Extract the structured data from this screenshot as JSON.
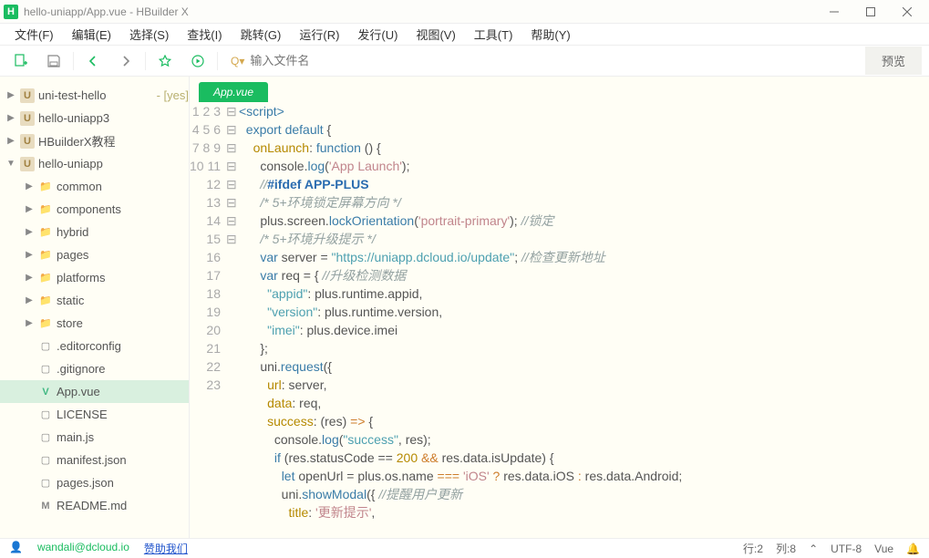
{
  "titlebar": {
    "appicon": "H",
    "title": "hello-uniapp/App.vue - HBuilder X"
  },
  "menubar": {
    "items": [
      "文件(F)",
      "编辑(E)",
      "选择(S)",
      "查找(I)",
      "跳转(G)",
      "运行(R)",
      "发行(U)",
      "视图(V)",
      "工具(T)",
      "帮助(Y)"
    ]
  },
  "toolbar": {
    "search_prefix": "Q▾",
    "search_placeholder": "输入文件名",
    "preview_label": "预览"
  },
  "sidebar": {
    "items": [
      {
        "depth": 0,
        "chev": "▶",
        "icon": "proj",
        "label": "uni-test-hello",
        "suffix": "- [yes]"
      },
      {
        "depth": 0,
        "chev": "▶",
        "icon": "proj",
        "label": "hello-uniapp3",
        "suffix": ""
      },
      {
        "depth": 0,
        "chev": "▶",
        "icon": "proj",
        "label": "HBuilderX教程",
        "suffix": ""
      },
      {
        "depth": 0,
        "chev": "▼",
        "icon": "proj",
        "label": "hello-uniapp",
        "suffix": ""
      },
      {
        "depth": 1,
        "chev": "▶",
        "icon": "folder",
        "label": "common",
        "suffix": ""
      },
      {
        "depth": 1,
        "chev": "▶",
        "icon": "folder",
        "label": "components",
        "suffix": ""
      },
      {
        "depth": 1,
        "chev": "▶",
        "icon": "folder",
        "label": "hybrid",
        "suffix": ""
      },
      {
        "depth": 1,
        "chev": "▶",
        "icon": "folder",
        "label": "pages",
        "suffix": ""
      },
      {
        "depth": 1,
        "chev": "▶",
        "icon": "folder",
        "label": "platforms",
        "suffix": ""
      },
      {
        "depth": 1,
        "chev": "▶",
        "icon": "folder",
        "label": "static",
        "suffix": ""
      },
      {
        "depth": 1,
        "chev": "▶",
        "icon": "folder",
        "label": "store",
        "suffix": ""
      },
      {
        "depth": 1,
        "chev": "",
        "icon": "file",
        "label": ".editorconfig",
        "suffix": ""
      },
      {
        "depth": 1,
        "chev": "",
        "icon": "file",
        "label": ".gitignore",
        "suffix": ""
      },
      {
        "depth": 1,
        "chev": "",
        "icon": "vue",
        "label": "App.vue",
        "suffix": "",
        "selected": true
      },
      {
        "depth": 1,
        "chev": "",
        "icon": "file",
        "label": "LICENSE",
        "suffix": ""
      },
      {
        "depth": 1,
        "chev": "",
        "icon": "file",
        "label": "main.js",
        "suffix": ""
      },
      {
        "depth": 1,
        "chev": "",
        "icon": "file",
        "label": "manifest.json",
        "suffix": ""
      },
      {
        "depth": 1,
        "chev": "",
        "icon": "file",
        "label": "pages.json",
        "suffix": ""
      },
      {
        "depth": 1,
        "chev": "",
        "icon": "md",
        "label": "README.md",
        "suffix": ""
      }
    ]
  },
  "editor": {
    "tab": "App.vue",
    "lines": [
      {
        "n": 1,
        "fold": "⊟",
        "html": "<span class='tag'>&lt;script&gt;</span>"
      },
      {
        "n": 2,
        "fold": "⊟",
        "html": "  <span class='kw'>export</span> <span class='kw'>default</span> {"
      },
      {
        "n": 3,
        "fold": "⊟",
        "html": "    <span class='id'>onLaunch</span>: <span class='kw'>function</span> () {"
      },
      {
        "n": 4,
        "fold": "",
        "html": "      console.<span class='fn'>log</span>(<span class='str2'>'App Launch'</span>);"
      },
      {
        "n": 5,
        "fold": "",
        "html": "      <span class='cmt'>//</span><span class='prep'>#ifdef APP-PLUS</span>"
      },
      {
        "n": 6,
        "fold": "",
        "html": "      <span class='cmt'>/* 5+环境锁定屏幕方向 */</span>"
      },
      {
        "n": 7,
        "fold": "",
        "html": "      plus.screen.<span class='fn'>lockOrientation</span>(<span class='str2'>'portrait-primary'</span>); <span class='cmt'>//锁定</span>"
      },
      {
        "n": 8,
        "fold": "",
        "html": "      <span class='cmt'>/* 5+环境升级提示 */</span>"
      },
      {
        "n": 9,
        "fold": "",
        "html": "      <span class='kw'>var</span> server = <span class='str'>\"https://uniapp.dcloud.io/update\"</span>; <span class='cmt'>//检查更新地址</span>"
      },
      {
        "n": 10,
        "fold": "⊟",
        "html": "      <span class='kw'>var</span> req = { <span class='cmt'>//升级检测数据</span>"
      },
      {
        "n": 11,
        "fold": "",
        "html": "        <span class='str'>\"appid\"</span>: plus.runtime.appid,"
      },
      {
        "n": 12,
        "fold": "",
        "html": "        <span class='str'>\"version\"</span>: plus.runtime.version,"
      },
      {
        "n": 13,
        "fold": "",
        "html": "        <span class='str'>\"imei\"</span>: plus.device.imei"
      },
      {
        "n": 14,
        "fold": "",
        "html": "      };"
      },
      {
        "n": 15,
        "fold": "⊟",
        "html": "      uni.<span class='fn'>request</span>({"
      },
      {
        "n": 16,
        "fold": "",
        "html": "        <span class='id'>url</span>: server,"
      },
      {
        "n": 17,
        "fold": "",
        "html": "        <span class='id'>data</span>: req,"
      },
      {
        "n": 18,
        "fold": "⊟",
        "html": "        <span class='id'>success</span>: (res) <span class='op'>=&gt;</span> {"
      },
      {
        "n": 19,
        "fold": "",
        "html": "          console.<span class='fn'>log</span>(<span class='str'>\"success\"</span>, res);"
      },
      {
        "n": 20,
        "fold": "⊟",
        "html": "          <span class='kw'>if</span> (res.statusCode == <span class='num'>200</span> <span class='op'>&amp;&amp;</span> res.data.isUpdate) {"
      },
      {
        "n": 21,
        "fold": "",
        "html": "            <span class='kw'>let</span> openUrl = plus.os.name <span class='op'>===</span> <span class='str2'>'iOS'</span> <span class='op'>?</span> res.data.iOS <span class='op'>:</span> res.data.Android;"
      },
      {
        "n": 22,
        "fold": "⊟",
        "html": "            uni.<span class='fn'>showModal</span>({ <span class='cmt'>//提醒用户更新</span>"
      },
      {
        "n": 23,
        "fold": "",
        "html": "              <span class='id'>title</span>: <span class='str2'>'更新提示'</span>,"
      }
    ]
  },
  "statusbar": {
    "email": "wandali@dcloud.io",
    "sponsor": "赞助我们",
    "line": "行:2",
    "col": "列:8",
    "encoding": "UTF-8",
    "lang": "Vue"
  }
}
